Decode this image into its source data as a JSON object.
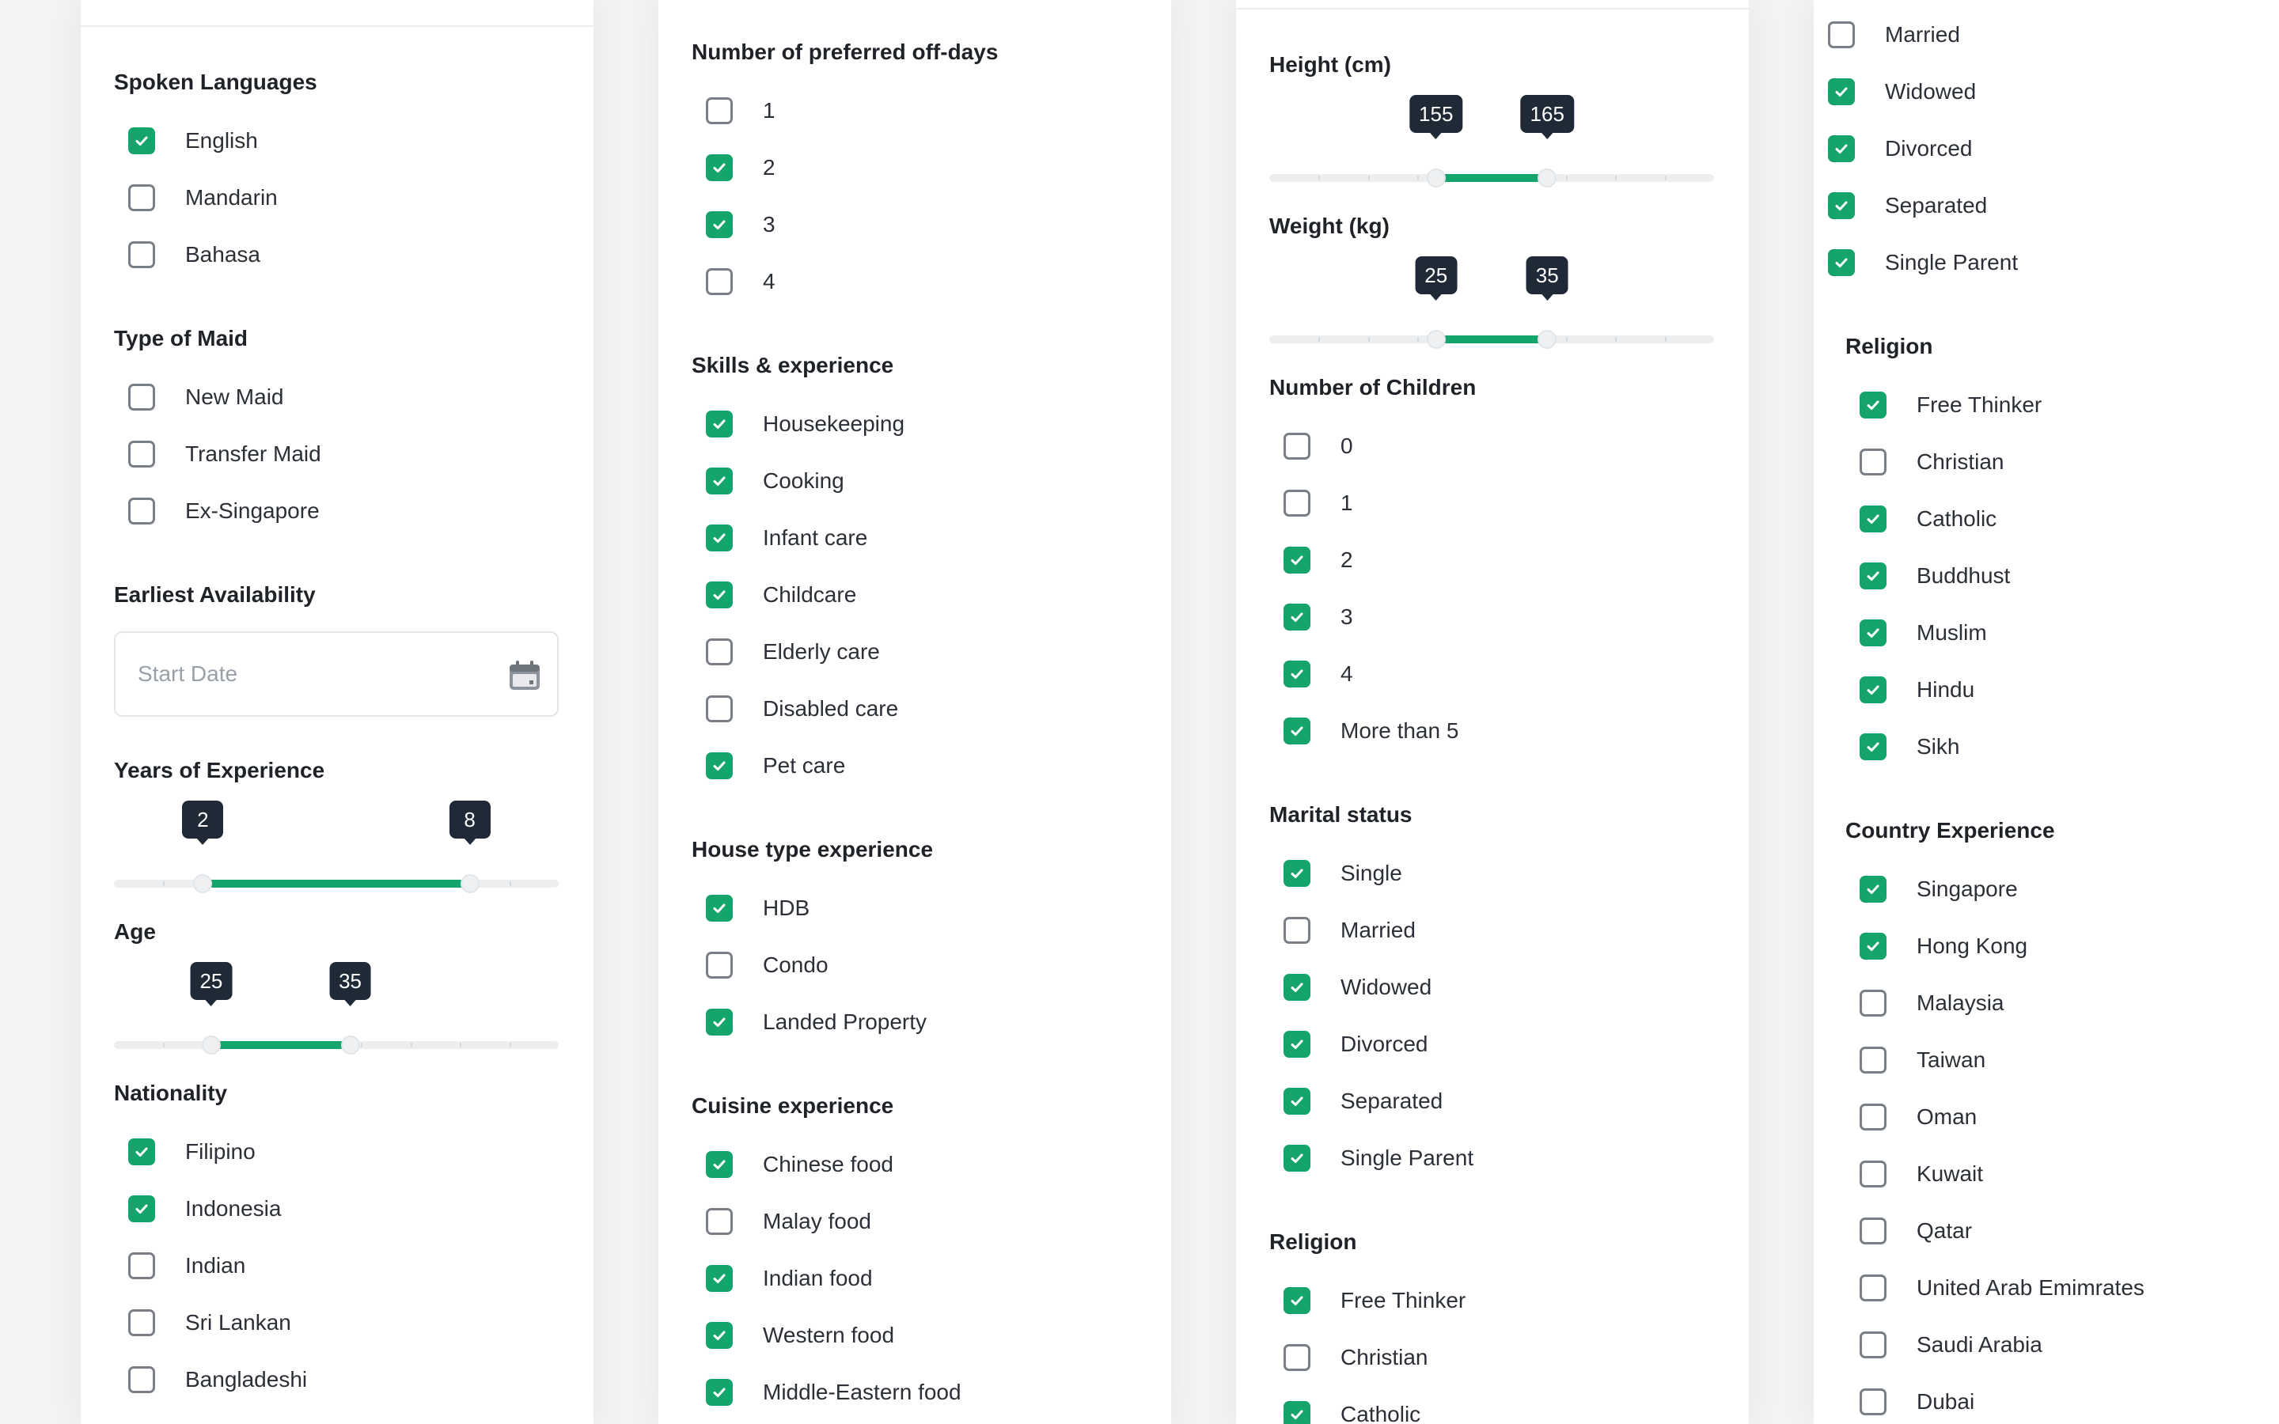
{
  "colors": {
    "accent": "#15a46b",
    "bubble": "#1f2a36",
    "unchecked_border": "#7a7f86"
  },
  "col1": {
    "spoken_languages": {
      "title": "Spoken Languages",
      "items": [
        {
          "label": "English",
          "checked": true
        },
        {
          "label": "Mandarin",
          "checked": false
        },
        {
          "label": "Bahasa",
          "checked": false
        }
      ]
    },
    "type_of_maid": {
      "title": "Type of Maid",
      "items": [
        {
          "label": "New Maid",
          "checked": false
        },
        {
          "label": "Transfer Maid",
          "checked": false
        },
        {
          "label": "Ex-Singapore",
          "checked": false
        }
      ]
    },
    "earliest_availability": {
      "title": "Earliest Availability",
      "placeholder": "Start Date",
      "icon": "calendar-icon"
    },
    "years_of_experience": {
      "title": "Years of Experience",
      "min_label": "2",
      "max_label": "8",
      "min": 2,
      "max": 8
    },
    "age": {
      "title": "Age",
      "min_label": "25",
      "max_label": "35",
      "min": 25,
      "max": 35
    },
    "nationality": {
      "title": "Nationality",
      "items": [
        {
          "label": "Filipino",
          "checked": true
        },
        {
          "label": "Indonesia",
          "checked": true
        },
        {
          "label": "Indian",
          "checked": false
        },
        {
          "label": "Sri Lankan",
          "checked": false
        },
        {
          "label": "Bangladeshi",
          "checked": false
        }
      ]
    }
  },
  "col2": {
    "off_days": {
      "title": "Number of preferred off-days",
      "items": [
        {
          "label": "1",
          "checked": false
        },
        {
          "label": "2",
          "checked": true
        },
        {
          "label": "3",
          "checked": true
        },
        {
          "label": "4",
          "checked": false
        }
      ]
    },
    "skills": {
      "title": "Skills & experience",
      "items": [
        {
          "label": "Housekeeping",
          "checked": true
        },
        {
          "label": "Cooking",
          "checked": true
        },
        {
          "label": "Infant care",
          "checked": true
        },
        {
          "label": "Childcare",
          "checked": true
        },
        {
          "label": "Elderly care",
          "checked": false
        },
        {
          "label": "Disabled care",
          "checked": false
        },
        {
          "label": "Pet care",
          "checked": true
        }
      ]
    },
    "house_type": {
      "title": "House type experience",
      "items": [
        {
          "label": "HDB",
          "checked": true
        },
        {
          "label": "Condo",
          "checked": false
        },
        {
          "label": "Landed Property",
          "checked": true
        }
      ]
    },
    "cuisine": {
      "title": "Cuisine experience",
      "items": [
        {
          "label": "Chinese food",
          "checked": true
        },
        {
          "label": "Malay food",
          "checked": false
        },
        {
          "label": "Indian food",
          "checked": true
        },
        {
          "label": "Western food",
          "checked": true
        },
        {
          "label": "Middle-Eastern food",
          "checked": true
        }
      ]
    }
  },
  "col3": {
    "height": {
      "title": "Height (cm)",
      "min_label": "155",
      "max_label": "165",
      "min": 155,
      "max": 165
    },
    "weight": {
      "title": "Weight (kg)",
      "min_label": "25",
      "max_label": "35",
      "min": 25,
      "max": 35
    },
    "children": {
      "title": "Number of Children",
      "items": [
        {
          "label": "0",
          "checked": false
        },
        {
          "label": "1",
          "checked": false
        },
        {
          "label": "2",
          "checked": true
        },
        {
          "label": "3",
          "checked": true
        },
        {
          "label": "4",
          "checked": true
        },
        {
          "label": "More than 5",
          "checked": true
        }
      ]
    },
    "marital": {
      "title": "Marital status",
      "items": [
        {
          "label": "Single",
          "checked": true
        },
        {
          "label": "Married",
          "checked": false
        },
        {
          "label": "Widowed",
          "checked": true
        },
        {
          "label": "Divorced",
          "checked": true
        },
        {
          "label": "Separated",
          "checked": true
        },
        {
          "label": "Single Parent",
          "checked": true
        }
      ]
    },
    "religion": {
      "title": "Religion",
      "items": [
        {
          "label": "Free Thinker",
          "checked": true
        },
        {
          "label": "Christian",
          "checked": false
        },
        {
          "label": "Catholic",
          "checked": true
        }
      ]
    }
  },
  "col4": {
    "marital_cont": {
      "items": [
        {
          "label": "Married",
          "checked": false
        },
        {
          "label": "Widowed",
          "checked": true
        },
        {
          "label": "Divorced",
          "checked": true
        },
        {
          "label": "Separated",
          "checked": true
        },
        {
          "label": "Single Parent",
          "checked": true
        }
      ]
    },
    "religion": {
      "title": "Religion",
      "items": [
        {
          "label": "Free Thinker",
          "checked": true
        },
        {
          "label": "Christian",
          "checked": false
        },
        {
          "label": "Catholic",
          "checked": true
        },
        {
          "label": "Buddhust",
          "checked": true
        },
        {
          "label": "Muslim",
          "checked": true
        },
        {
          "label": "Hindu",
          "checked": true
        },
        {
          "label": "Sikh",
          "checked": true
        }
      ]
    },
    "country": {
      "title": "Country Experience",
      "items": [
        {
          "label": "Singapore",
          "checked": true
        },
        {
          "label": "Hong Kong",
          "checked": true
        },
        {
          "label": "Malaysia",
          "checked": false
        },
        {
          "label": "Taiwan",
          "checked": false
        },
        {
          "label": "Oman",
          "checked": false
        },
        {
          "label": "Kuwait",
          "checked": false
        },
        {
          "label": "Qatar",
          "checked": false
        },
        {
          "label": "United Arab Emimrates",
          "checked": false
        },
        {
          "label": "Saudi Arabia",
          "checked": false
        },
        {
          "label": "Dubai",
          "checked": false
        }
      ]
    }
  }
}
